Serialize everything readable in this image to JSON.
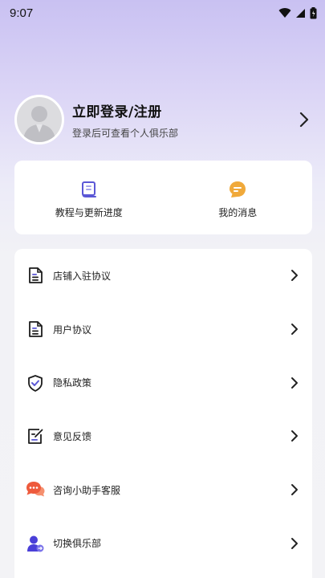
{
  "status_bar": {
    "time": "9:07"
  },
  "profile": {
    "title": "立即登录/注册",
    "subtitle": "登录后可查看个人俱乐部"
  },
  "quick_actions": [
    {
      "label": "教程与更新进度",
      "icon": "book-icon",
      "color": "#5b57d6"
    },
    {
      "label": "我的消息",
      "icon": "chat-bubble-icon",
      "color": "#f0a93a"
    }
  ],
  "menu": {
    "items": [
      {
        "label": "店铺入驻协议",
        "icon": "document-icon"
      },
      {
        "label": "用户协议",
        "icon": "document-icon"
      },
      {
        "label": "隐私政策",
        "icon": "shield-check-icon"
      },
      {
        "label": "意见反馈",
        "icon": "edit-note-icon"
      },
      {
        "label": "咨询小助手客服",
        "icon": "chat-bubbles-icon",
        "color": "#ee5a3c"
      },
      {
        "label": "切换俱乐部",
        "icon": "user-switch-icon",
        "color": "#4a3fd8"
      }
    ]
  },
  "colors": {
    "accent_purple": "#5b57d6",
    "accent_orange": "#f0a93a",
    "accent_red": "#ee5a3c"
  }
}
